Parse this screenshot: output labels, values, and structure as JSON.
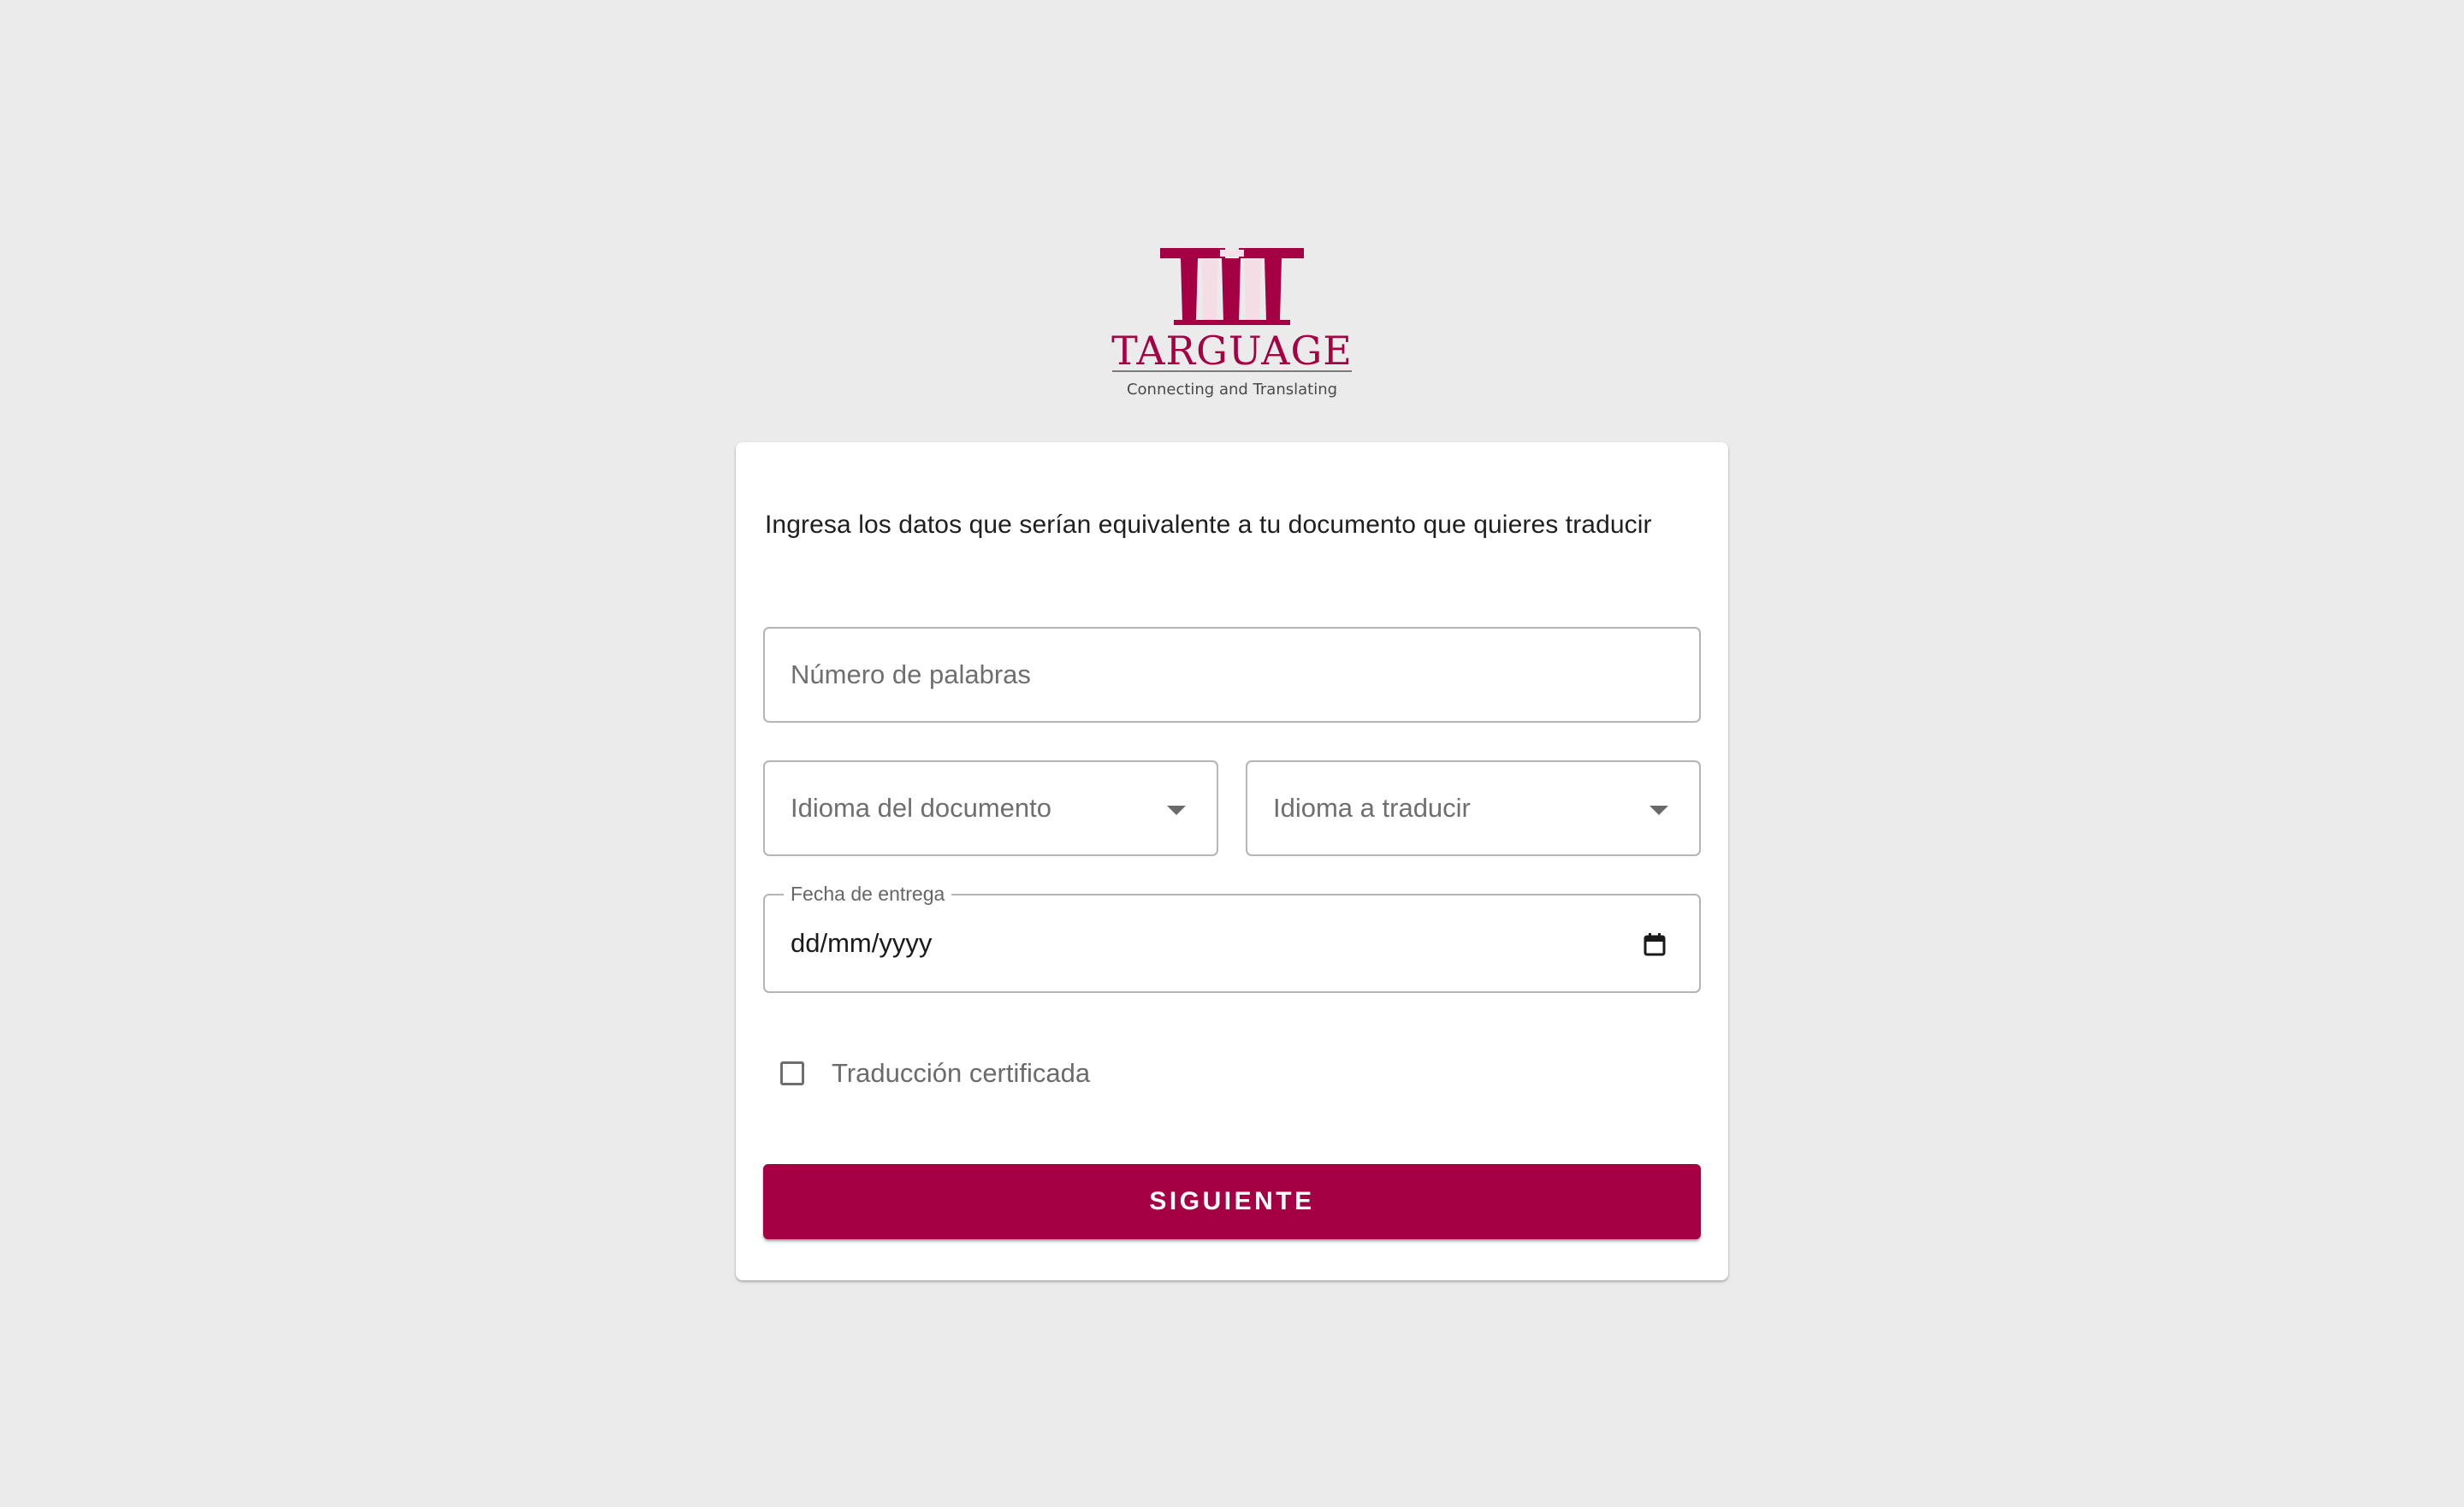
{
  "brand": {
    "name": "Targuage",
    "tagline": "Connecting and Translating",
    "color": "#a50043"
  },
  "form": {
    "instructions": "Ingresa los datos que serían equivalente a tu documento que quieres traducir",
    "word_count": {
      "placeholder": "Número de palabras",
      "value": ""
    },
    "source_language": {
      "placeholder": "Idioma del documento",
      "selected": ""
    },
    "target_language": {
      "placeholder": "Idioma a traducir",
      "selected": ""
    },
    "delivery_date": {
      "label": "Fecha de entrega",
      "value_format": "dd/mm/yyyy",
      "icon": "calendar-icon"
    },
    "certified": {
      "label": "Traducción certificada",
      "checked": false
    },
    "next_button_label": "SIGUIENTE"
  },
  "colors": {
    "background": "#ebebeb",
    "card": "#ffffff",
    "accent": "#a50043",
    "field_border": "#b5b5b5"
  }
}
